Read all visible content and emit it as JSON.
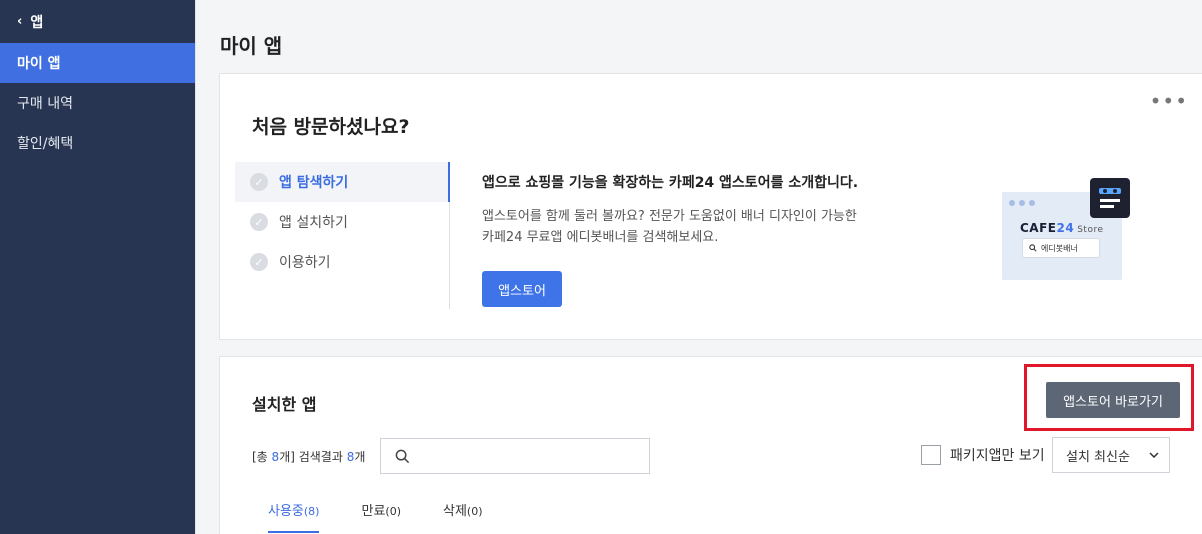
{
  "sidebar": {
    "back_label": "앱",
    "items": [
      {
        "label": "마이 앱",
        "active": true
      },
      {
        "label": "구매 내역",
        "active": false
      },
      {
        "label": "할인/혜택",
        "active": false
      }
    ]
  },
  "page": {
    "title": "마이 앱"
  },
  "intro": {
    "title": "처음 방문하셨나요?",
    "more_label": "•••",
    "steps": [
      {
        "label": "앱 탐색하기",
        "active": true
      },
      {
        "label": "앱 설치하기",
        "active": false
      },
      {
        "label": "이용하기",
        "active": false
      }
    ],
    "heading": "앱으로 쇼핑몰 기능을 확장하는 카페24 앱스토어를 소개합니다.",
    "desc_line1": "앱스토어를 함께 둘러 볼까요? 전문가 도움없이 배너 디자인이 가능한",
    "desc_line2": "카페24 무료앱 에디봇배너를 검색해보세요.",
    "button_label": "앱스토어",
    "illustration": {
      "logo_main": "CAFE",
      "logo_num": "24",
      "logo_suffix": "Store",
      "search_text": "에디봇배너"
    }
  },
  "installed": {
    "title": "설치한 앱",
    "store_button": "앱스토어 바로가기",
    "count_prefix": "[총 ",
    "total": "8",
    "count_mid": "개] 검색결과 ",
    "results": "8",
    "count_suffix": "개",
    "search_placeholder": "",
    "package_only_label": "패키지앱만 보기",
    "sort_selected": "설치 최신순",
    "tabs": [
      {
        "label": "사용중",
        "count": "(8)",
        "active": true
      },
      {
        "label": "만료",
        "count": "(0)",
        "active": false
      },
      {
        "label": "삭제",
        "count": "(0)",
        "active": false
      }
    ]
  },
  "colors": {
    "sidebar_bg": "#273552",
    "accent": "#3f73e8",
    "highlight": "#e0162b"
  }
}
